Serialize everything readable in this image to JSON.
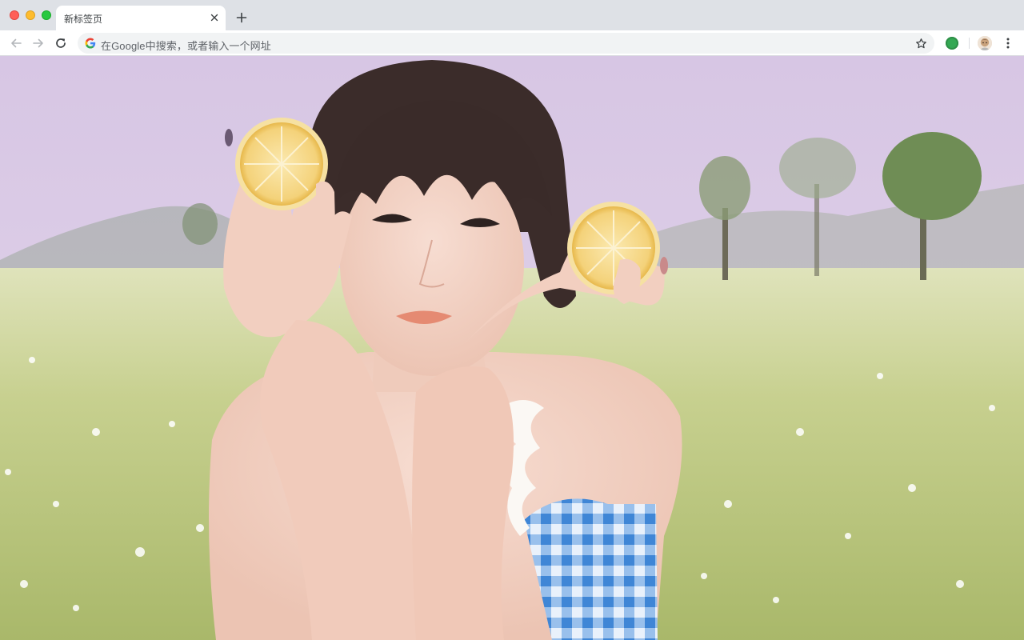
{
  "tab": {
    "title": "新标签页"
  },
  "omnibox": {
    "placeholder": "在Google中搜索，或者输入一个网址"
  },
  "icons": {
    "back": "arrow-left-icon",
    "forward": "arrow-right-icon",
    "reload": "reload-icon",
    "search_engine": "google-g-icon",
    "bookmark": "star-icon",
    "extension": "extension-icon",
    "profile": "avatar",
    "menu": "kebab-menu-icon"
  },
  "colors": {
    "tabstrip": "#dee1e6",
    "omnibox": "#f1f3f4",
    "extension": "#34a853"
  }
}
